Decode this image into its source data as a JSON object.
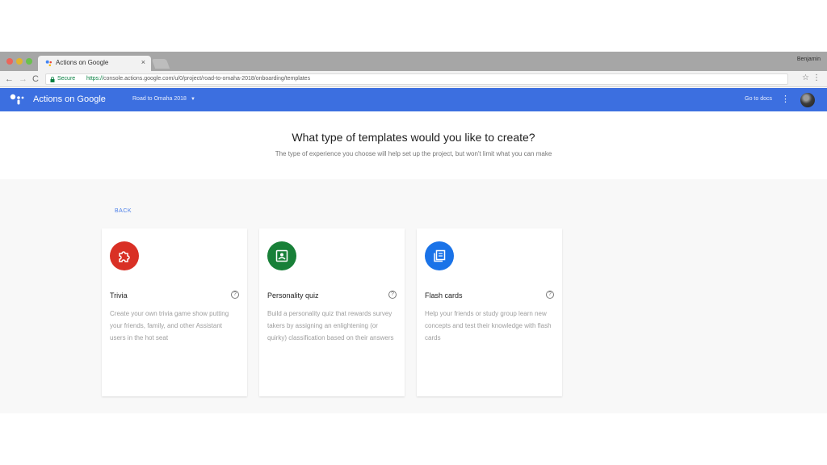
{
  "browser": {
    "tab_title": "Actions on Google",
    "tab_close": "×",
    "profile_name": "Benjamin",
    "nav": {
      "back": "←",
      "forward": "→",
      "reload": "C"
    },
    "secure_label": "Secure",
    "url_scheme": "https://",
    "url_rest": "console.actions.google.com/u/0/project/road-to-omaha-2018/onboarding/templates",
    "star": "☆",
    "menu": "⋮"
  },
  "app": {
    "title": "Actions on Google",
    "project_name": "Road to Omaha 2018",
    "project_caret": "▼",
    "go_to_docs": "Go to docs",
    "more": "⋮"
  },
  "page": {
    "title": "What type of templates would you like to create?",
    "subtitle": "The type of experience you choose will help set up the project, but won't limit what you can make",
    "back_label": "BACK"
  },
  "cards": [
    {
      "title": "Trivia",
      "help": "?",
      "description": "Create your own trivia game show putting your friends, family, and other Assistant users in the hot seat",
      "icon": "puzzle-icon",
      "color": "#d93025"
    },
    {
      "title": "Personality quiz",
      "help": "?",
      "description": "Build a personality quiz that rewards survey takers by assigning an enlightening (or quirky) classification based on their answers",
      "icon": "portrait-icon",
      "color": "#188038"
    },
    {
      "title": "Flash cards",
      "help": "?",
      "description": "Help your friends or study group learn new concepts and test their knowledge with flash cards",
      "icon": "cards-icon",
      "color": "#1a73e8"
    }
  ],
  "colors": {
    "header_blue": "#3c6fe0",
    "link_blue": "#4a7ee8"
  }
}
